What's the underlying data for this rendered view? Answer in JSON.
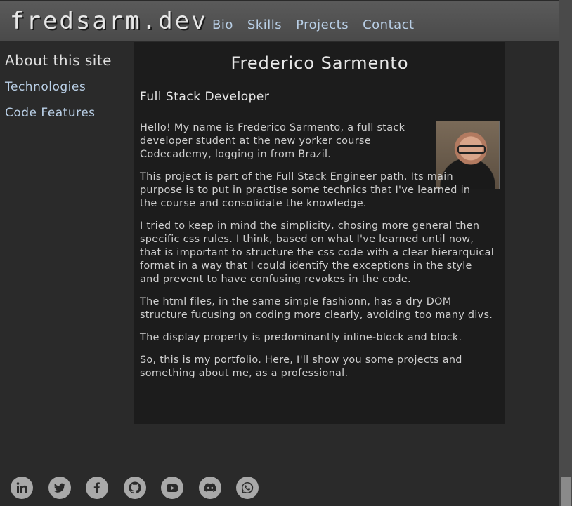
{
  "header": {
    "brand": "fredsarm.dev",
    "nav": [
      "Bio",
      "Skills",
      "Projects",
      "Contact"
    ]
  },
  "sidebar": {
    "title": "About this site",
    "items": [
      "Technologies",
      "Code Features"
    ]
  },
  "main": {
    "title": "Frederico Sarmento",
    "subtitle": "Full Stack Developer",
    "paragraphs": [
      "Hello! My name is Frederico Sarmento, a full stack developer student at the new yorker course Codecademy, logging in from Brazil.",
      "This project is part of the Full Stack Engineer path. Its main purpose is to put in practise some technics that I've learned in the course and consolidate the knowledge.",
      "I tried to keep in mind the simplicity, chosing more general then specific css rules. I think, based on what I've learned until now, that is important to structure the css code with a clear hierarquical format in a way that I could identify the exceptions in the style and prevent to have confusing revokes in the code.",
      "The html files, in the same simple fashionn, has a dry DOM structure fucusing on coding more clearly, avoiding too many divs.",
      "The display property is predominantly inline-block and block.",
      "So, this is my portfolio. Here, I'll show you some projects and something about me, as a professional."
    ]
  },
  "social": {
    "icons": [
      "linkedin-icon",
      "twitter-icon",
      "facebook-icon",
      "github-icon",
      "youtube-icon",
      "discord-icon",
      "whatsapp-icon"
    ]
  },
  "colors": {
    "background": "#2a2a2a",
    "panel": "#1c1c1c",
    "header": "#4f4f4f",
    "link": "#b9cfe6",
    "text": "#cfcfcf",
    "icon": "#a9a9a9"
  }
}
